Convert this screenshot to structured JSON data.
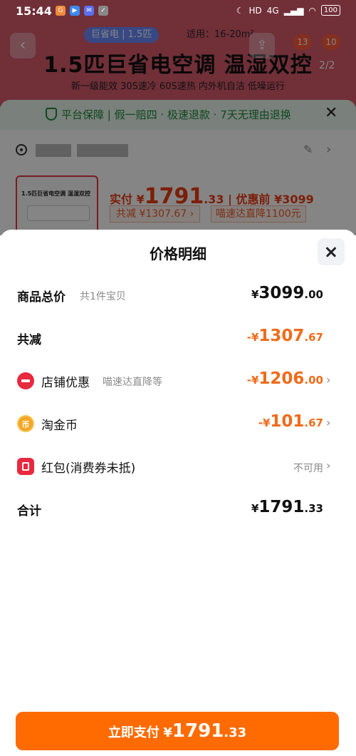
{
  "status_bar": {
    "time": "15:44",
    "network": "4G",
    "battery": "100"
  },
  "background": {
    "tag": "巨省电 | 1.5匹",
    "fit": "适用：16-20m²",
    "hero_title": "1.5匹巨省电空调 温湿双控",
    "hero_sub": "新一级能效  30S速冷 60S速热  内外机自洁  低噪运行",
    "badge_a": "13",
    "badge_b": "10",
    "page_indicator": "2/2",
    "guarantee": "平台保障 | 假一赔四 · 极速退款 · 7天无理由退换",
    "thumb_title": "1.5匹巨省电空调 温湿双控",
    "pay_prefix": "实付 ¥",
    "pay_int": "1791",
    "pay_dec": ".33",
    "pay_before": " | 优惠前 ¥3099",
    "reduce_tag": "共减 ¥1307.67 ›",
    "miao_tag": "喵速达直降1100元"
  },
  "sheet": {
    "title": "价格明细",
    "rows": {
      "total": {
        "label": "商品总价",
        "sub": "共1件宝贝",
        "cur": "¥",
        "int": "3099",
        "dec": ".00"
      },
      "reduce": {
        "label": "共减",
        "cur": "-¥",
        "int": "1307",
        "dec": ".67"
      },
      "shop": {
        "label": "店铺优惠",
        "sub": "喵速达直降等",
        "cur": "-¥",
        "int": "1206",
        "dec": ".00"
      },
      "coin": {
        "label": "淘金币",
        "cur": "-¥",
        "int": "101",
        "dec": ".67",
        "icon_text": "币"
      },
      "redpack": {
        "label": "红包(消费券未抵)",
        "status": "不可用"
      },
      "sum": {
        "label": "合计",
        "cur": "¥",
        "int": "1791",
        "dec": ".33"
      }
    },
    "chevron": "›"
  },
  "pay_button": {
    "label": "立即支付",
    "cur": "¥",
    "int": "1791",
    "dec": ".33"
  },
  "colors": {
    "accent": "#ff6b00",
    "discount": "#f06b1a",
    "shop_icon": "#e8293e",
    "coin_icon": "#f5a623"
  }
}
